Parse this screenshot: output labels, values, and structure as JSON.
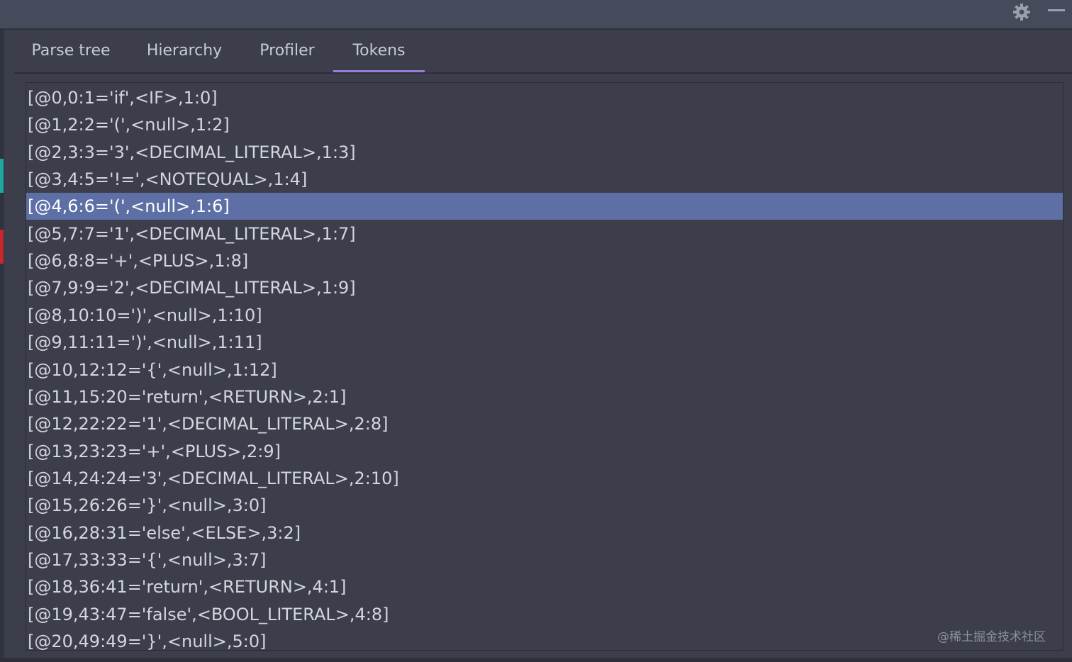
{
  "window": {
    "icons": [
      "gear-icon",
      "minimize-icon"
    ]
  },
  "tabs": [
    {
      "label": "Parse tree",
      "active": false
    },
    {
      "label": "Hierarchy",
      "active": false
    },
    {
      "label": "Profiler",
      "active": false
    },
    {
      "label": "Tokens",
      "active": true
    }
  ],
  "tokens": {
    "selected_index": 4,
    "rows": [
      "[@0,0:1='if',<IF>,1:0]",
      "[@1,2:2='(',<null>,1:2]",
      "[@2,3:3='3',<DECIMAL_LITERAL>,1:3]",
      "[@3,4:5='!=',<NOTEQUAL>,1:4]",
      "[@4,6:6='(',<null>,1:6]",
      "[@5,7:7='1',<DECIMAL_LITERAL>,1:7]",
      "[@6,8:8='+',<PLUS>,1:8]",
      "[@7,9:9='2',<DECIMAL_LITERAL>,1:9]",
      "[@8,10:10=')',<null>,1:10]",
      "[@9,11:11=')',<null>,1:11]",
      "[@10,12:12='{',<null>,1:12]",
      "[@11,15:20='return',<RETURN>,2:1]",
      "[@12,22:22='1',<DECIMAL_LITERAL>,2:8]",
      "[@13,23:23='+',<PLUS>,2:9]",
      "[@14,24:24='3',<DECIMAL_LITERAL>,2:10]",
      "[@15,26:26='}',<null>,3:0]",
      "[@16,28:31='else',<ELSE>,3:2]",
      "[@17,33:33='{',<null>,3:7]",
      "[@18,36:41='return',<RETURN>,4:1]",
      "[@19,43:47='false',<BOOL_LITERAL>,4:8]",
      "[@20,49:49='}',<null>,5:0]"
    ]
  },
  "watermark": "@稀土掘金技术社区",
  "colors": {
    "background": "#3c3f4b",
    "selection": "#5e6fa6",
    "active_tab_underline": "#9b7dd8",
    "text": "#d3d6dd"
  }
}
